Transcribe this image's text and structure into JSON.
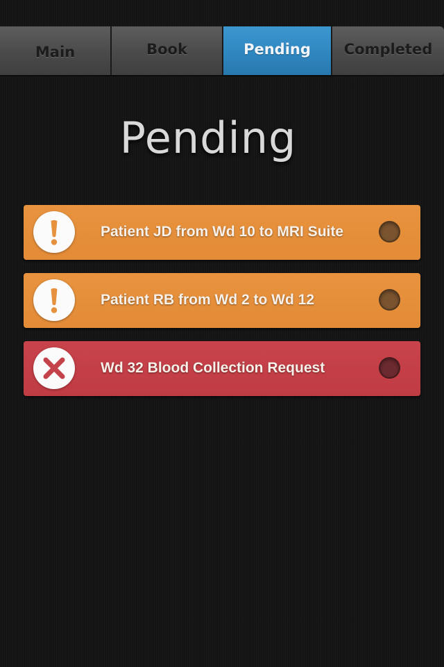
{
  "tabs": {
    "main": "Main",
    "book": "Book",
    "pending": "Pending",
    "completed": "Completed",
    "active": "pending"
  },
  "page": {
    "title": "Pending"
  },
  "requests": [
    {
      "label": "Patient JD from Wd 10 to MRI Suite",
      "status": "warning",
      "icon": "exclamation-icon",
      "color": "#E68F3B"
    },
    {
      "label": "Patient RB from Wd 2 to Wd 12",
      "status": "warning",
      "icon": "exclamation-icon",
      "color": "#E68F3B"
    },
    {
      "label": "Wd 32 Blood Collection Request",
      "status": "error",
      "icon": "cross-icon",
      "color": "#C43F47"
    }
  ],
  "colors": {
    "background": "#141414",
    "tab_active": "#338DC5",
    "tab_inactive": "#4E4E4E",
    "warning": "#E68F3B",
    "error": "#C43F47"
  }
}
